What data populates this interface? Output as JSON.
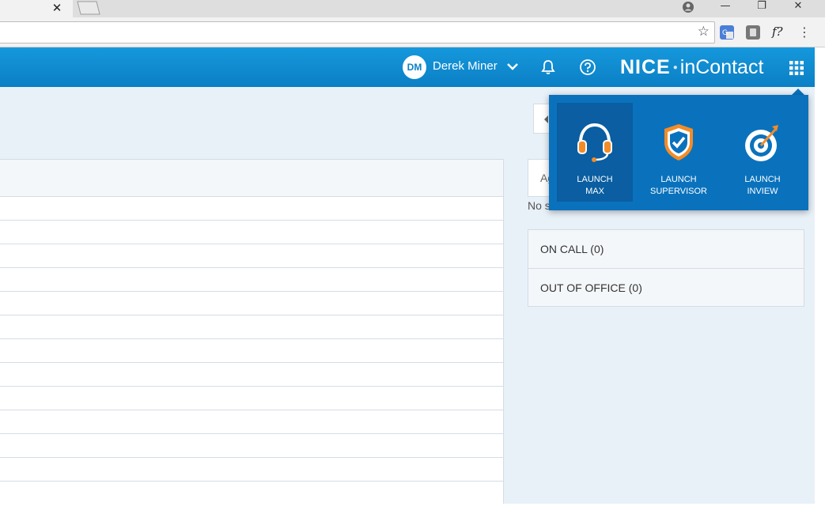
{
  "browser": {
    "tab_close": "✕",
    "window_controls": [
      "—",
      "❐",
      "✕"
    ],
    "bookmark_icon": "☆",
    "ext_fx": "f?",
    "menu": "⋮"
  },
  "header": {
    "avatar_initials": "DM",
    "user_name": "Derek Miner",
    "brand_main": "NICE",
    "brand_dot": "●",
    "brand_sub": "inContact",
    "brand_color": "#0b7fc5"
  },
  "side": {
    "search_prefix": "Ag",
    "no_staff": "No s",
    "cards": [
      {
        "label": "ON CALL (0)"
      },
      {
        "label": "OUT OF OFFICE (0)"
      }
    ]
  },
  "launcher": {
    "tiles": [
      {
        "line1": "LAUNCH",
        "line2": "MAX",
        "icon": "headset-icon"
      },
      {
        "line1": "LAUNCH",
        "line2": "SUPERVISOR",
        "icon": "shield-check-icon"
      },
      {
        "line1": "LAUNCH",
        "line2": "INVIEW",
        "icon": "target-icon"
      }
    ],
    "accent_orange": "#f28c28"
  }
}
